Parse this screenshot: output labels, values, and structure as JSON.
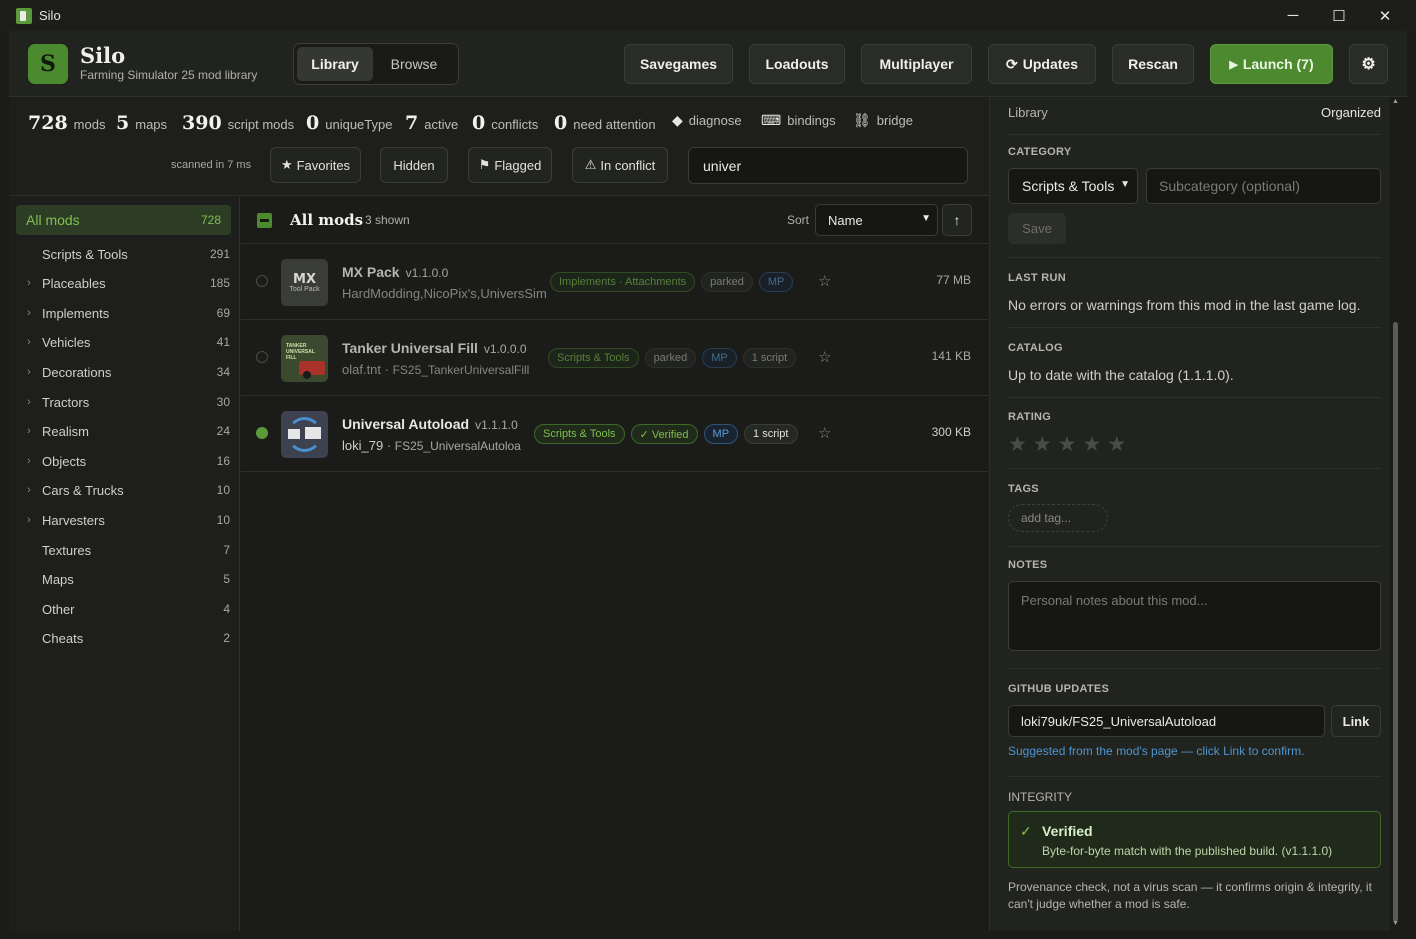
{
  "window": {
    "title": "Silo",
    "minimize": "─",
    "maximize": "☐",
    "close": "✕"
  },
  "header": {
    "logo_letter": "S",
    "brand": "Silo",
    "subtitle": "Farming Simulator 25 mod library",
    "tabs": [
      {
        "label": "Library",
        "active": true
      },
      {
        "label": "Browse",
        "active": false
      }
    ],
    "buttons": {
      "savegames": "Savegames",
      "loadouts": "Loadouts",
      "multiplayer": "Multiplayer",
      "updates": "Updates",
      "rescan": "Rescan",
      "launch": "Launch (7)"
    }
  },
  "stats": {
    "mods": {
      "num": "728",
      "label": "mods"
    },
    "maps": {
      "num": "5",
      "label": "maps"
    },
    "script_mods": {
      "num": "390",
      "label": "script mods"
    },
    "unique_type": {
      "num": "0",
      "label": "uniqueType"
    },
    "active": {
      "num": "7",
      "label": "active"
    },
    "conflicts": {
      "num": "0",
      "label": "conflicts"
    },
    "need_attention": {
      "num": "0",
      "label": "need attention"
    },
    "diagnose": "diagnose",
    "bindings": "bindings",
    "bridge": "bridge",
    "scanned": "scanned in 7 ms"
  },
  "filters": {
    "favorites": "Favorites",
    "hidden": "Hidden",
    "flagged": "Flagged",
    "in_conflict": "In conflict",
    "search_value": "univer"
  },
  "sidebar": {
    "all": {
      "label": "All mods",
      "count": "728"
    },
    "items": [
      {
        "label": "Scripts & Tools",
        "count": "291",
        "expandable": false
      },
      {
        "label": "Placeables",
        "count": "185",
        "expandable": true
      },
      {
        "label": "Implements",
        "count": "69",
        "expandable": true
      },
      {
        "label": "Vehicles",
        "count": "41",
        "expandable": true
      },
      {
        "label": "Decorations",
        "count": "34",
        "expandable": true
      },
      {
        "label": "Tractors",
        "count": "30",
        "expandable": true
      },
      {
        "label": "Realism",
        "count": "24",
        "expandable": true
      },
      {
        "label": "Objects",
        "count": "16",
        "expandable": true
      },
      {
        "label": "Cars & Trucks",
        "count": "10",
        "expandable": true
      },
      {
        "label": "Harvesters",
        "count": "10",
        "expandable": true
      },
      {
        "label": "Textures",
        "count": "7",
        "expandable": false
      },
      {
        "label": "Maps",
        "count": "5",
        "expandable": false
      },
      {
        "label": "Other",
        "count": "4",
        "expandable": false
      },
      {
        "label": "Cheats",
        "count": "2",
        "expandable": false
      }
    ]
  },
  "list": {
    "title": "All mods",
    "count": "3 shown",
    "sort_label": "Sort",
    "sort_value": "Name",
    "sort_dir": "↑",
    "rows": [
      {
        "name": "MX Pack",
        "version": "v1.1.0.0",
        "author": "HardModding,NicoPix's,UniversSim",
        "tags": [
          "Implements · Attachments",
          "parked",
          "MP"
        ],
        "size": "77 MB",
        "active": false,
        "thumb_text": "MX",
        "thumb_sub": "Tool Pack"
      },
      {
        "name": "Tanker Universal Fill",
        "version": "v1.0.0.0",
        "author": "olaf.tnt",
        "file": "FS25_TankerUniversalFill",
        "tags": [
          "Scripts & Tools",
          "parked",
          "MP",
          "1 script"
        ],
        "size": "141 KB",
        "active": false,
        "thumb_text": "TANKER UNIVERSAL FILL"
      },
      {
        "name": "Universal Autoload",
        "version": "v1.1.1.0",
        "author": "loki_79",
        "file": "FS25_UniversalAutoloa",
        "tags": [
          "Scripts & Tools",
          "✓ Verified",
          "MP",
          "1 script"
        ],
        "size": "300 KB",
        "active": true
      }
    ]
  },
  "detail": {
    "library_label": "Library",
    "library_value": "Organized",
    "category_head": "CATEGORY",
    "category_value": "Scripts & Tools",
    "subcategory_placeholder": "Subcategory (optional)",
    "save": "Save",
    "last_run_head": "LAST RUN",
    "last_run_text": "No errors or warnings from this mod in the last game log.",
    "catalog_head": "CATALOG",
    "catalog_text": "Up to date with the catalog (1.1.1.0).",
    "rating_head": "RATING",
    "rating_value": 0,
    "tags_head": "TAGS",
    "tag_placeholder": "add tag...",
    "notes_head": "NOTES",
    "notes_placeholder": "Personal notes about this mod...",
    "github_head": "GITHUB UPDATES",
    "github_value": "loki79uk/FS25_UniversalAutoload",
    "link": "Link",
    "suggest": "Suggested from the mod's page — click Link to confirm.",
    "integrity_head": "INTEGRITY",
    "verified_title": "Verified",
    "verified_desc": "Byte-for-byte match with the published build. (v1.1.1.0)",
    "provenance": "Provenance check, not a virus scan — it confirms origin & integrity, it can't judge whether a mod is safe."
  },
  "colors": {
    "accent": "#4d8a2f",
    "accent_text": "#7fbf52",
    "mp_blue": "#5c9fd6"
  }
}
